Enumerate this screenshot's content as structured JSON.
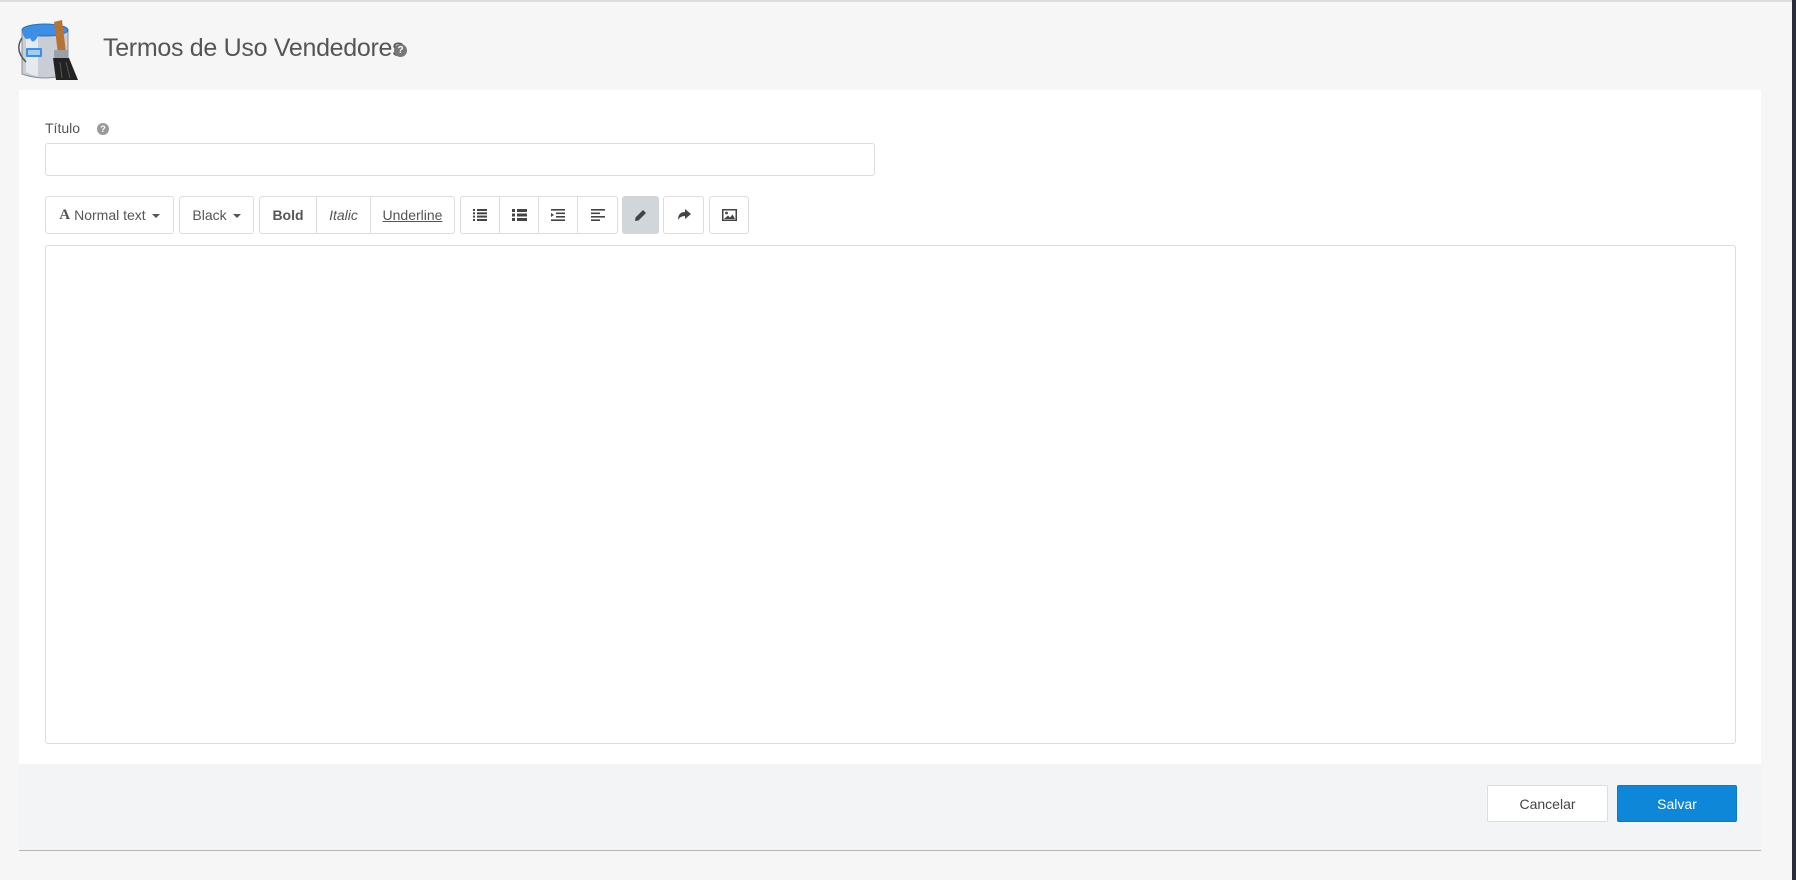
{
  "header": {
    "title": "Termos de Uso Vendedores",
    "help_glyph": "?",
    "logo_icon": "paint-bucket-brush-icon"
  },
  "form": {
    "title_label": "Título",
    "help_glyph": "?",
    "title_value": "",
    "title_placeholder": ""
  },
  "toolbar": {
    "font_style_glyph": "A",
    "font_style": "Normal text",
    "font_color": "Black",
    "bold": "Bold",
    "italic": "Italic",
    "underline": "Underline",
    "icons": [
      "unordered-list-icon",
      "ordered-list-icon",
      "outdent-icon",
      "indent-icon",
      "pencil-icon",
      "redo-icon",
      "image-icon"
    ]
  },
  "editor": {
    "content": ""
  },
  "footer": {
    "cancel_label": "Cancelar",
    "save_label": "Salvar"
  },
  "colors": {
    "primary": "#0e87d9",
    "page_background": "#f6f6f6",
    "footer_background": "#f3f4f5",
    "active_tool": "#d1d6db"
  }
}
